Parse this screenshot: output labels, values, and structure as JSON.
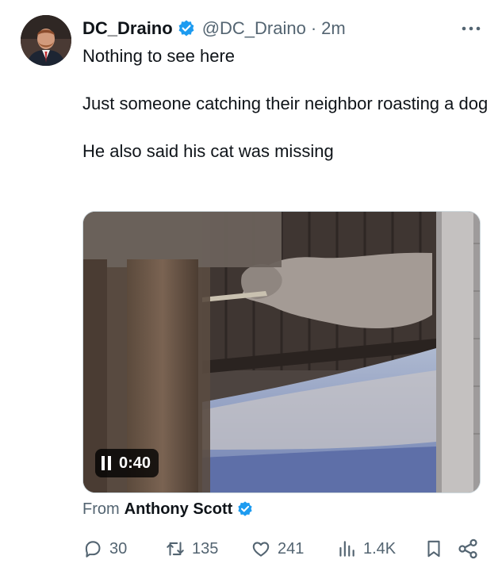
{
  "author": {
    "display_name": "DC_Draino",
    "handle": "@DC_Draino",
    "separator": "·",
    "time": "2m",
    "verified_icon": "verified-badge-icon"
  },
  "tweet": {
    "lines": [
      "Nothing to see here",
      "Just someone catching their neighbor roasting a dog",
      "He also said his cat was missing"
    ]
  },
  "video": {
    "duration": "0:40",
    "state_icon": "pause-icon"
  },
  "attribution": {
    "label": "From",
    "name": "Anthony Scott"
  },
  "actions": {
    "replies": "30",
    "reposts": "135",
    "likes": "241",
    "views": "1.4K"
  },
  "colors": {
    "text": "#0f1419",
    "secondary": "#536471",
    "verified": "#1d9bf0"
  }
}
